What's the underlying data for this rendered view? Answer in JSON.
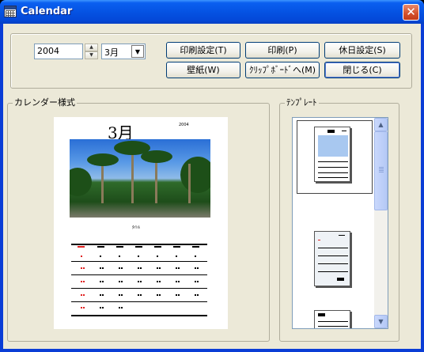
{
  "window": {
    "title": "Calendar",
    "close_label": "✕"
  },
  "controls": {
    "year_value": "2004",
    "month_value": "3月",
    "spin_up": "▲",
    "spin_down": "▼",
    "dropdown_arrow": "▼"
  },
  "buttons": {
    "print_settings": "印刷設定(T)",
    "print": "印刷(P)",
    "holiday_settings": "休日設定(S)",
    "wallpaper": "壁紙(W)",
    "clipboard": "ｸﾘｯﾌﾟﾎﾞｰﾄﾞへ(M)",
    "close": "閉じる(C)"
  },
  "groups": {
    "calendar_style": "カレンダー様式",
    "template": "ﾃﾝﾌﾟﾚｰﾄ"
  },
  "preview": {
    "month_title": "3月",
    "year_small": "2004",
    "caption": "ﾀｲﾄﾙ"
  },
  "scrollbar": {
    "up": "▲",
    "down": "▼"
  },
  "colors": {
    "title_bar": "#0553e3",
    "close_button": "#d4502a",
    "face": "#ece9d8",
    "template_sky": "#a8c8f0"
  }
}
